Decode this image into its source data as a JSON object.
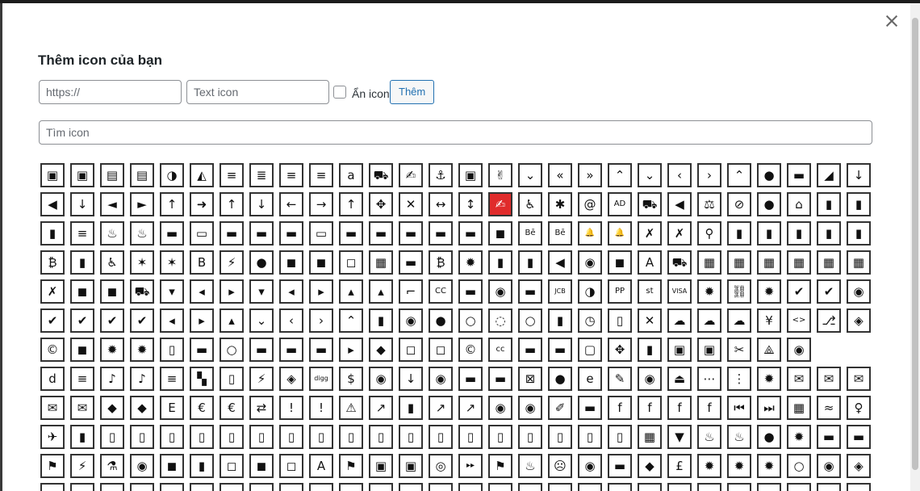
{
  "modal": {
    "title": "Thêm icon của bạn",
    "url_placeholder": "https://",
    "url_value": "",
    "text_placeholder": "Text icon",
    "hide_icon_label": "Ẩn icon",
    "add_button": "Thêm",
    "search_placeholder": "Tìm icon"
  },
  "icon_grid": {
    "rows": [
      [
        "▣",
        "▣",
        "▤",
        "▤",
        "◑",
        "◭",
        "≡",
        "≣",
        "≡",
        "≡",
        "a",
        "⛟",
        "✍",
        "⚓",
        "▣",
        "✌",
        "⌄",
        "«",
        "»",
        "⌃",
        "⌄",
        "‹",
        "›",
        "⌃",
        "●",
        "▬",
        "◢",
        "↓"
      ],
      [
        "◀",
        "↓",
        "◄",
        "►",
        "↑",
        "➜",
        "↑",
        "↓",
        "←",
        "→",
        "↑",
        "✥",
        "✕",
        "↔",
        "↕",
        "✍",
        "♿",
        "✱",
        "@",
        "AD",
        "⛟",
        "◀",
        "⚖",
        "⊘",
        "●",
        "⌂",
        "▮",
        "▮"
      ],
      [
        "▮",
        "≡",
        "♨",
        "♨",
        "▬",
        "▭",
        "▬",
        "▬",
        "▬",
        "▭",
        "▬",
        "▬",
        "▬",
        "▬",
        "▬",
        "◼",
        "Bē",
        "Bē",
        "🔔",
        "🔔",
        "✗",
        "✗",
        "⚲",
        "▮",
        "▮",
        "▮",
        "▮",
        "▮"
      ],
      [
        "₿",
        "▮",
        "♿",
        "✶",
        "✶",
        "B",
        "⚡",
        "●",
        "◼",
        "◼",
        "◻",
        "▦",
        "▬",
        "₿",
        "✹",
        "▮",
        "▮",
        "◀",
        "◉",
        "◼",
        "A",
        "⛟",
        "▦",
        "▦",
        "▦",
        "▦",
        "▦",
        "▦"
      ],
      [
        "✗",
        "◼",
        "◼",
        "⛟",
        "▾",
        "◂",
        "▸",
        "▾",
        "◂",
        "▸",
        "▴",
        "▴",
        "⌐",
        "CC",
        "▬",
        "◉",
        "▬",
        "JCB",
        "◑",
        "PP",
        "st",
        "VISA",
        "✹",
        "⛓",
        "✹",
        "✔",
        "✔",
        "◉"
      ],
      [
        "✔",
        "✔",
        "✔",
        "✔",
        "◂",
        "▸",
        "▴",
        "⌄",
        "‹",
        "›",
        "⌃",
        "▮",
        "◉",
        "●",
        "○",
        "◌",
        "○",
        "▮",
        "◷",
        "▯",
        "✕",
        "☁",
        "☁",
        "☁",
        "¥",
        "<>",
        "⎇",
        "◈"
      ],
      [
        "©",
        "◼",
        "✹",
        "✹",
        "▯",
        "▬",
        "○",
        "▬",
        "▬",
        "▬",
        "▸",
        "◆",
        "◻",
        "◻",
        "©",
        "cc",
        "▬",
        "▬",
        "▢",
        "✥",
        "▮",
        "▣",
        "▣",
        "✂",
        "⟁",
        "◉"
      ],
      [
        "d",
        "≡",
        "♪",
        "♪",
        "≡",
        "▚",
        "▯",
        "⚡",
        "◈",
        "digg",
        "$",
        "◉",
        "↓",
        "◉",
        "▬",
        "▬",
        "⊠",
        "●",
        "e",
        "✎",
        "◉",
        "⏏",
        "⋯",
        "⋮",
        "✹",
        "✉",
        "✉",
        "✉"
      ],
      [
        "✉",
        "✉",
        "◆",
        "◆",
        "E",
        "€",
        "€",
        "⇄",
        "!",
        "!",
        "⚠",
        "↗",
        "▮",
        "↗",
        "↗",
        "◉",
        "◉",
        "✐",
        "▬",
        "f",
        "f",
        "f",
        "f",
        "⏮",
        "⏭",
        "▦",
        "≈",
        "♀"
      ],
      [
        "✈",
        "▮",
        "▯",
        "▯",
        "▯",
        "▯",
        "▯",
        "▯",
        "▯",
        "▯",
        "▯",
        "▯",
        "▯",
        "▯",
        "▯",
        "▯",
        "▯",
        "▯",
        "▯",
        "▯",
        "▦",
        "▼",
        "♨",
        "♨",
        "●",
        "✹",
        "▬",
        "▬"
      ],
      [
        "⚑",
        "⚡",
        "⚗",
        "◉",
        "◼",
        "▮",
        "◻",
        "◼",
        "◻",
        "A",
        "⚑",
        "▣",
        "▣",
        "◎",
        "▸▸",
        "⚑",
        "♨",
        "☹",
        "◉",
        "▬",
        "◆",
        "£",
        "✹",
        "✹",
        "✹",
        "○",
        "◉",
        "◈"
      ],
      [
        "",
        "",
        "",
        "",
        "",
        "",
        "",
        "",
        "",
        "",
        "",
        "",
        "",
        "",
        "",
        "",
        "",
        "",
        "",
        "",
        "",
        "",
        "",
        "",
        "",
        "",
        "",
        ""
      ]
    ]
  }
}
